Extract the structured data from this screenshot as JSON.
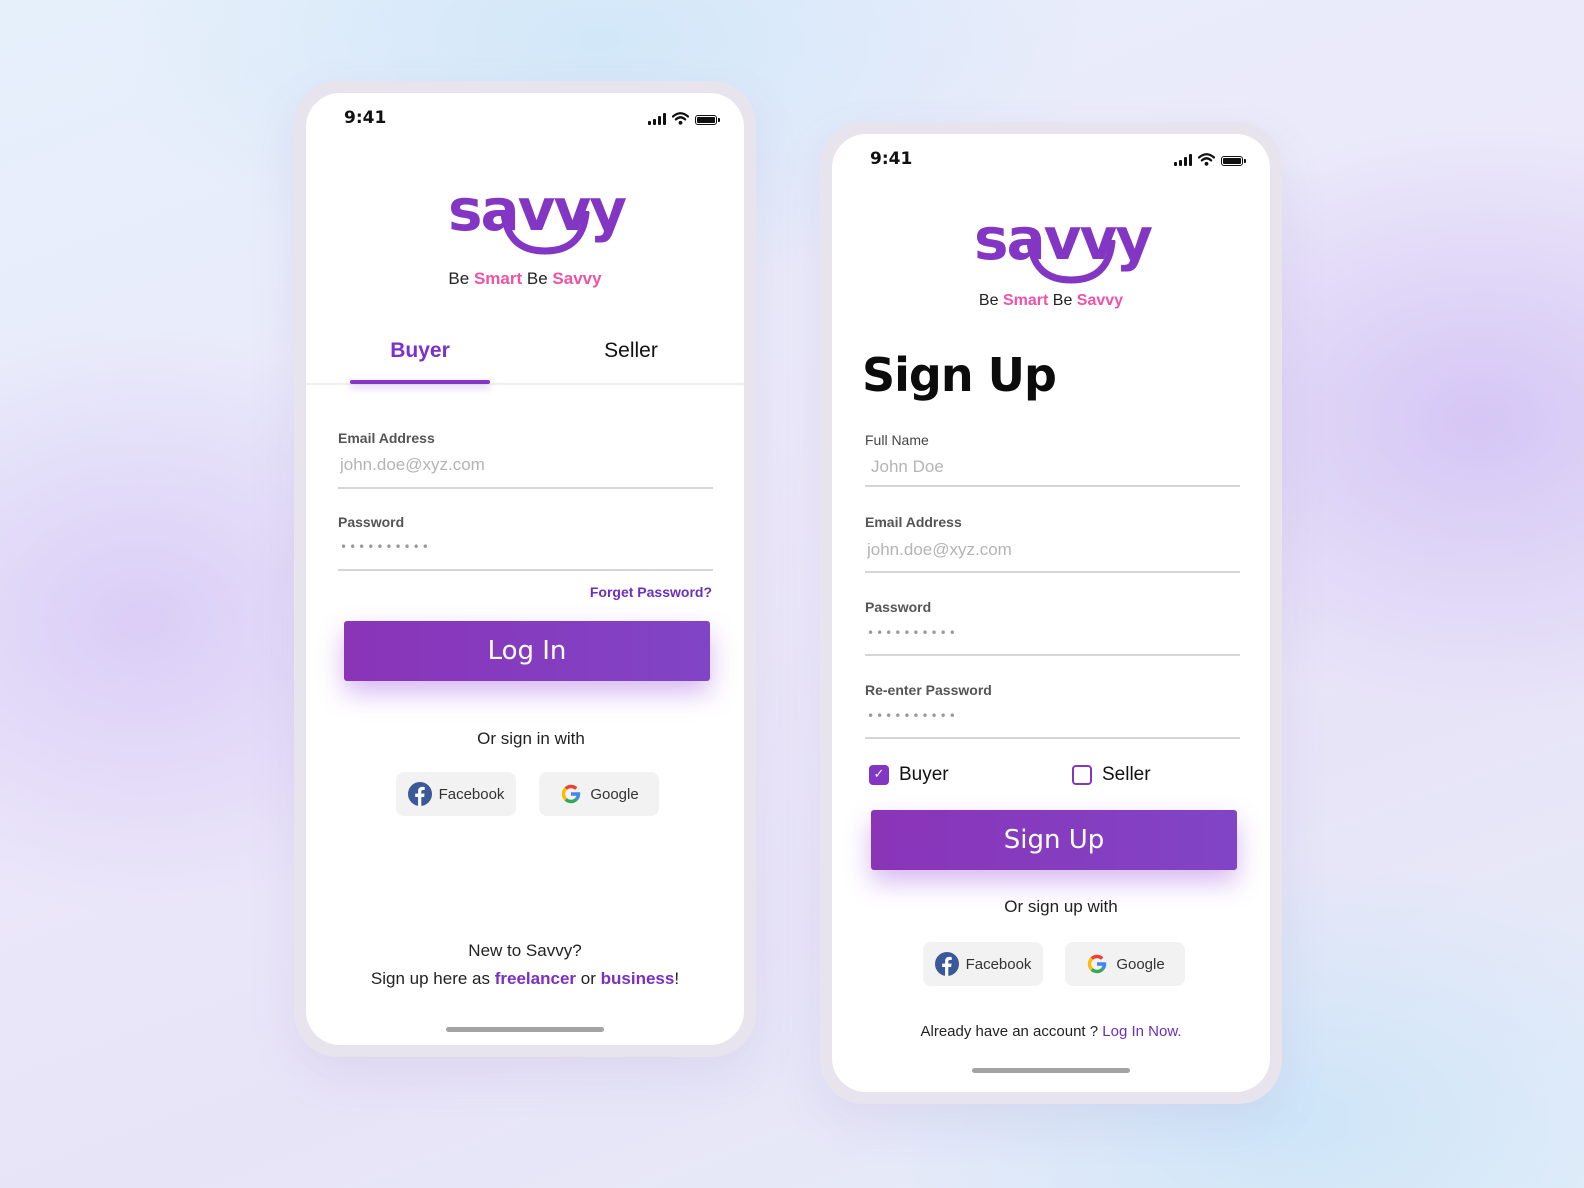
{
  "login_screen": {
    "status_time": "9:41",
    "logo_text": "savvy",
    "tagline": {
      "be1": "Be",
      "smart": "Smart",
      "be2": "Be",
      "savvy": "Savvy"
    },
    "tabs": [
      {
        "label": "Buyer",
        "active": true
      },
      {
        "label": "Seller",
        "active": false
      }
    ],
    "email": {
      "label": "Email Address",
      "placeholder": "john.doe@xyz.com"
    },
    "password": {
      "label": "Password",
      "masked_value": "••••••••••"
    },
    "forget_password": "Forget Password?",
    "login_button": "Log In",
    "or_sign_in_with": "Or sign in with",
    "facebook_label": "Facebook",
    "google_label": "Google",
    "new_to": "New to Savvy?",
    "signup_prefix": "Sign up here as",
    "freelancer": "freelancer",
    "or_word": "or",
    "business": "business",
    "exclamation": "!"
  },
  "signup_screen": {
    "status_time": "9:41",
    "logo_text": "savvy",
    "tagline": {
      "be1": "Be",
      "smart": "Smart",
      "be2": "Be",
      "savvy": "Savvy"
    },
    "title": "Sign Up",
    "full_name": {
      "label": "Full Name",
      "placeholder": "John Doe"
    },
    "email": {
      "label": "Email Address",
      "placeholder": "john.doe@xyz.com"
    },
    "password": {
      "label": "Password",
      "masked_value": "••••••••••"
    },
    "reenter_password": {
      "label": "Re-enter Password",
      "masked_value": "••••••••••"
    },
    "buyer_checkbox": {
      "label": "Buyer",
      "checked": true
    },
    "seller_checkbox": {
      "label": "Seller",
      "checked": false
    },
    "signup_button": "Sign Up",
    "or_sign_up_with": "Or sign up with",
    "facebook_label": "Facebook",
    "google_label": "Google",
    "already_have": "Already have an account ?",
    "login_now": "Log In Now."
  },
  "colors": {
    "brand_purple": "#8336c4",
    "accent_pink": "#f052a8",
    "facebook_blue": "#3b5998"
  }
}
